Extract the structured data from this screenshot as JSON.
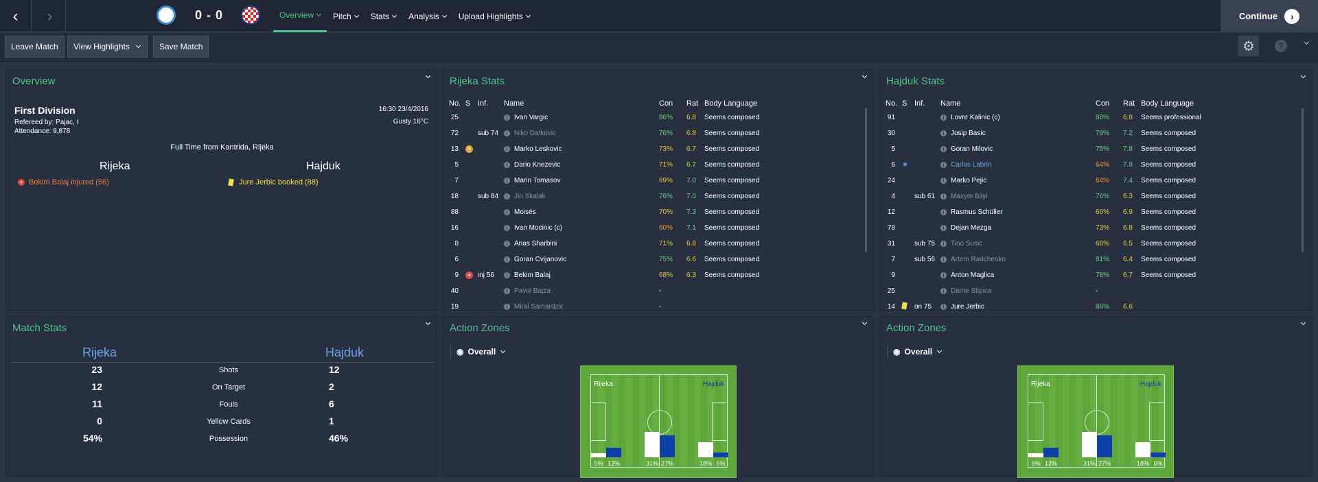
{
  "nav": {
    "score": "0 - 0",
    "tabs": [
      "Overview",
      "Pitch",
      "Stats",
      "Analysis",
      "Upload Highlights"
    ],
    "continue": "Continue"
  },
  "toolbar": {
    "leave": "Leave Match",
    "highlights": "View Highlights",
    "save": "Save Match",
    "help": "?"
  },
  "overview": {
    "title": "Overview",
    "division": "First Division",
    "referee": "Refereed by: Pajac, I",
    "attendance": "Attendance: 9,878",
    "datetime": "16:30 23/4/2016",
    "weather": "Gusty 16°C",
    "result": "Full Time from Kantrida, Rijeka",
    "home": "Rijeka",
    "away": "Hajduk",
    "home_event": "Bekim Balaj injured (56)",
    "away_event": "Jure Jerbic booked (88)"
  },
  "rijeka": {
    "title": "Rijeka Stats",
    "headers": [
      "No.",
      "S",
      "Inf.",
      "Name",
      "Con",
      "Rat",
      "Body Language"
    ],
    "rows": [
      [
        "25",
        "",
        "",
        "Ivan Vargic",
        "86%",
        "6.8",
        "Seems composed"
      ],
      [
        "72",
        "",
        "sub 74",
        "Niko Datkovic",
        "76%",
        "6.8",
        "Seems composed"
      ],
      [
        "13",
        "+",
        "",
        "Marko Leskovic",
        "73%",
        "6.7",
        "Seems composed"
      ],
      [
        "5",
        "",
        "",
        "Dario Knezevic",
        "71%",
        "6.7",
        "Seems composed"
      ],
      [
        "7",
        "",
        "",
        "Marin Tomasov",
        "69%",
        "7.0",
        "Seems composed"
      ],
      [
        "18",
        "",
        "sub 84",
        "Jiri Skalak",
        "76%",
        "7.0",
        "Seems composed"
      ],
      [
        "88",
        "",
        "",
        "Moisés",
        "70%",
        "7.3",
        "Seems composed"
      ],
      [
        "16",
        "",
        "",
        "Ivan Mocinic (c)",
        "60%",
        "7.1",
        "Seems composed"
      ],
      [
        "8",
        "",
        "",
        "Anas Sharbini",
        "71%",
        "6.8",
        "Seems composed"
      ],
      [
        "6",
        "",
        "",
        "Goran Cvijanovic",
        "75%",
        "6.6",
        "Seems composed"
      ],
      [
        "9",
        "+",
        "inj 56",
        "Bekim Balaj",
        "68%",
        "6.3",
        "Seems composed"
      ],
      [
        "40",
        "",
        "",
        "Pavol Bajza",
        "-",
        "",
        ""
      ],
      [
        "19",
        "",
        "",
        "Miral Samardzic",
        "-",
        "",
        ""
      ]
    ]
  },
  "hajduk": {
    "title": "Hajduk Stats",
    "headers": [
      "No.",
      "S",
      "Inf.",
      "Name",
      "Con",
      "Rat",
      "Body Language"
    ],
    "rows": [
      [
        "91",
        "",
        "",
        "Lovre Kalinic (c)",
        "88%",
        "6.8",
        "Seems professional"
      ],
      [
        "30",
        "",
        "",
        "Josip Basic",
        "79%",
        "7.2",
        "Seems composed"
      ],
      [
        "5",
        "",
        "",
        "Goran Milovic",
        "75%",
        "7.8",
        "Seems composed"
      ],
      [
        "6",
        "★",
        "",
        "Carlos Labrin",
        "64%",
        "7.8",
        "Seems composed"
      ],
      [
        "24",
        "",
        "",
        "Marko Pejic",
        "64%",
        "7.4",
        "Seems composed"
      ],
      [
        "4",
        "",
        "sub 61",
        "Maxym Bilyi",
        "76%",
        "6.3",
        "Seems composed"
      ],
      [
        "12",
        "",
        "",
        "Rasmus Schüller",
        "66%",
        "6.9",
        "Seems composed"
      ],
      [
        "78",
        "",
        "",
        "Dejan Mezga",
        "73%",
        "6.8",
        "Seems composed"
      ],
      [
        "31",
        "",
        "sub 75",
        "Tino Susic",
        "68%",
        "6.5",
        "Seems composed"
      ],
      [
        "7",
        "",
        "sub 56",
        "Artem Radchenko",
        "81%",
        "6.4",
        "Seems composed"
      ],
      [
        "9",
        "",
        "",
        "Anton Maglica",
        "78%",
        "6.7",
        "Seems composed"
      ],
      [
        "25",
        "",
        "",
        "Dante Stipica",
        "-",
        "",
        ""
      ],
      [
        "14",
        "■",
        "on 75",
        "Jure Jerbic",
        "86%",
        "6.6",
        ""
      ]
    ]
  },
  "match_stats": {
    "title": "Match Stats",
    "home": "Rijeka",
    "away": "Hajduk",
    "rows": [
      [
        "23",
        "Shots",
        "12"
      ],
      [
        "12",
        "On Target",
        "2"
      ],
      [
        "11",
        "Fouls",
        "6"
      ],
      [
        "0",
        "Yellow Cards",
        "1"
      ],
      [
        "54%",
        "Possession",
        "46%"
      ]
    ]
  },
  "zones": {
    "title": "Action Zones",
    "filter": "Overall",
    "home": "Rijeka",
    "away": "Hajduk",
    "home_pct": [
      5,
      31,
      18
    ],
    "away_pct": [
      12,
      27,
      6
    ],
    "labels": [
      "5%",
      "12%",
      "31%",
      "27%",
      "18%",
      "6%"
    ]
  },
  "colors": {
    "accent": "#4fc28a",
    "home_blue": "#6aa4ec",
    "away_bar": "#0d3fa8"
  }
}
